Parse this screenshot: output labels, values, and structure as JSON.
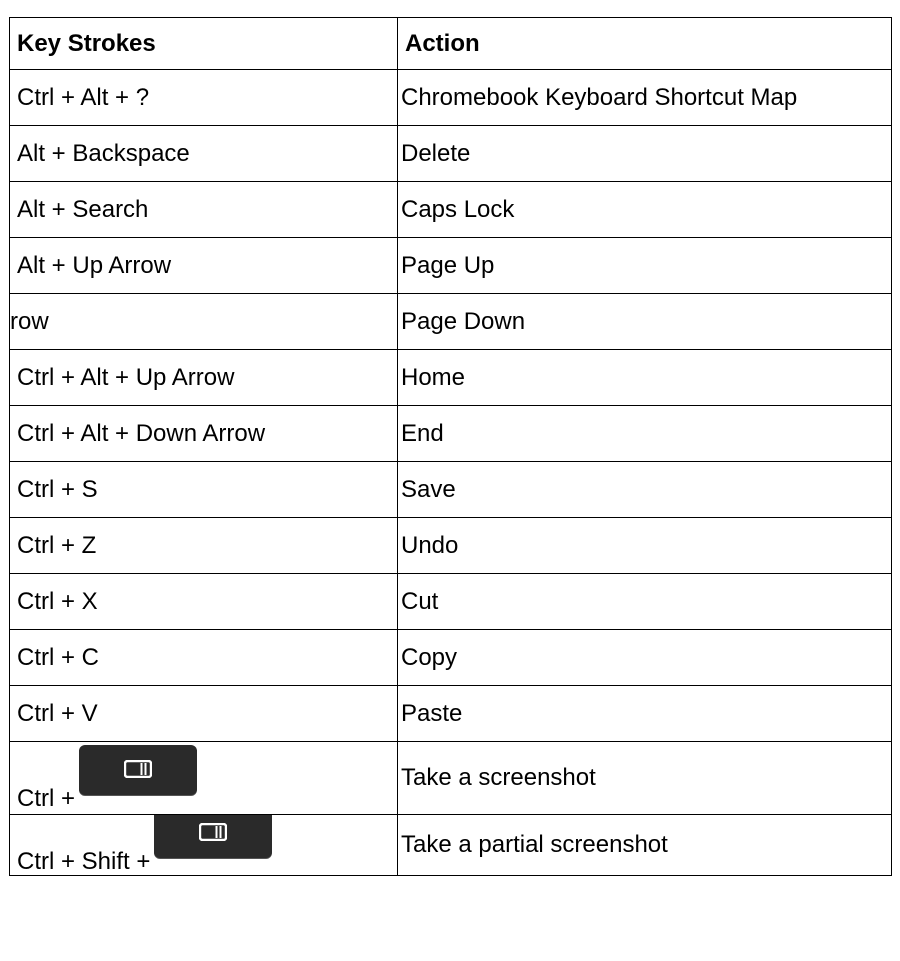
{
  "table": {
    "headers": {
      "keys": "Key Strokes",
      "action": "Action"
    },
    "rows": [
      {
        "keys": "Ctrl + Alt + ?",
        "action": "Chromebook Keyboard Shortcut Map"
      },
      {
        "keys": "Alt + Backspace",
        "action": "Delete"
      },
      {
        "keys": "Alt + Search",
        "action": "Caps Lock"
      },
      {
        "keys": "Alt + Up Arrow",
        "action": "Page Up"
      },
      {
        "keys": "row",
        "action": "Page Down"
      },
      {
        "keys": "Ctrl + Alt + Up Arrow",
        "action": "Home"
      },
      {
        "keys": "Ctrl + Alt + Down Arrow",
        "action": "End"
      },
      {
        "keys": "Ctrl + S",
        "action": "Save"
      },
      {
        "keys": "Ctrl + Z",
        "action": "Undo"
      },
      {
        "keys": "Ctrl + X",
        "action": "Cut"
      },
      {
        "keys": "Ctrl + C",
        "action": "Copy"
      },
      {
        "keys": "Ctrl + V",
        "action": "Paste"
      },
      {
        "keys": "Ctrl +",
        "action": "Take a screenshot",
        "key_icon": "show-windows-key-icon"
      },
      {
        "keys": "Ctrl + Shift +",
        "action": "Take a partial screenshot",
        "key_icon": "show-windows-key-icon"
      }
    ]
  },
  "colors": {
    "border": "#000000",
    "key_cap": "#2a2a2a",
    "key_icon": "#ffffff"
  }
}
